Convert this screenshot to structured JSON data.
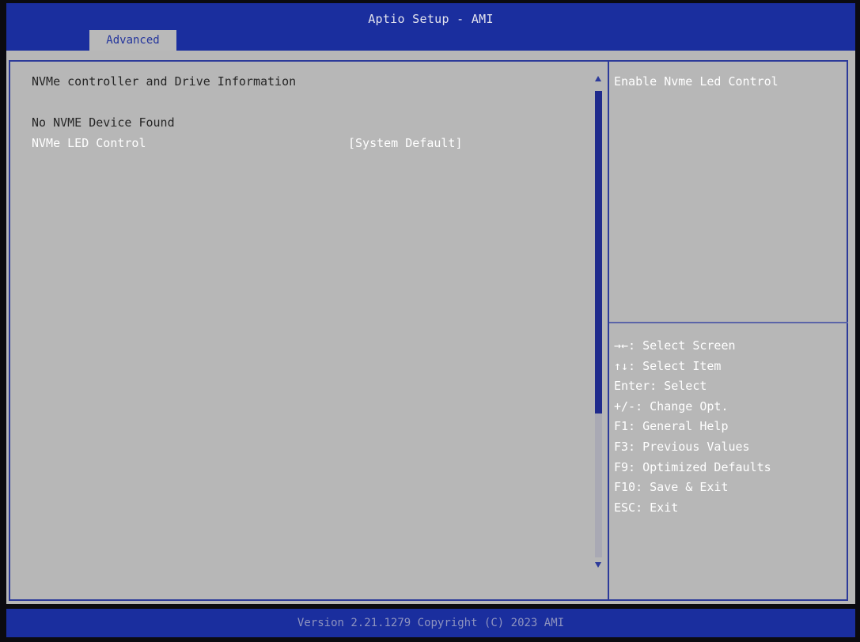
{
  "header": {
    "title": "Aptio Setup - AMI"
  },
  "tabs": [
    {
      "label": "Advanced"
    }
  ],
  "main": {
    "section_title": "NVMe controller and Drive Information",
    "status": "No NVME Device Found",
    "settings": [
      {
        "label": "NVMe LED Control",
        "value": "[System Default]"
      }
    ]
  },
  "help": {
    "description": "Enable Nvme Led Control",
    "keys": [
      "→←: Select Screen",
      "↑↓: Select Item",
      "Enter: Select",
      "+/-: Change Opt.",
      "F1: General Help",
      "F3: Previous Values",
      "F9: Optimized Defaults",
      "F10: Save & Exit",
      "ESC: Exit"
    ]
  },
  "footer": {
    "text": "Version 2.21.1279 Copyright (C) 2023 AMI"
  },
  "colors": {
    "header_bg": "#1a2e9e",
    "panel_bg": "#b7b7b7",
    "border": "#2c3a9a",
    "selected_text": "#ffffff",
    "text": "#262626"
  }
}
